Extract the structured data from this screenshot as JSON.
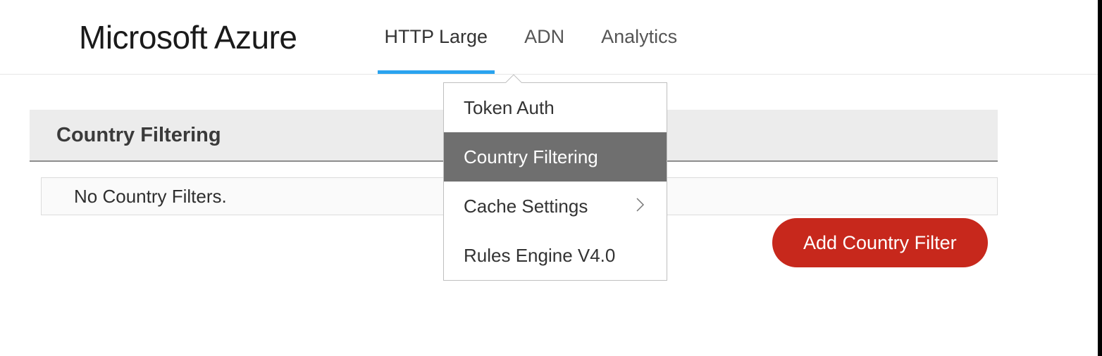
{
  "header": {
    "logo": "Microsoft Azure",
    "tabs": [
      {
        "label": "HTTP Large",
        "active": true
      },
      {
        "label": "ADN",
        "active": false
      },
      {
        "label": "Analytics",
        "active": false
      }
    ]
  },
  "dropdown": {
    "items": [
      {
        "label": "Token Auth",
        "selected": false,
        "hasSubmenu": false
      },
      {
        "label": "Country Filtering",
        "selected": true,
        "hasSubmenu": false
      },
      {
        "label": "Cache Settings",
        "selected": false,
        "hasSubmenu": true
      },
      {
        "label": "Rules Engine V4.0",
        "selected": false,
        "hasSubmenu": false
      }
    ]
  },
  "main": {
    "section_title": "Country Filtering",
    "empty_message": "No Country Filters.",
    "add_button_label": "Add Country Filter"
  }
}
